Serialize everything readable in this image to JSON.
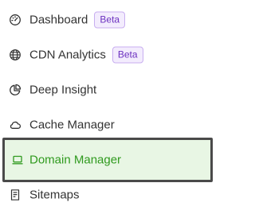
{
  "colors": {
    "text": "#333333",
    "active_text": "#2f9a1e",
    "active_bg": "#e8f6e4",
    "active_border": "#4a4a4a",
    "badge_text": "#6b2fbf",
    "badge_bg": "#f3ecfd",
    "badge_border": "#c8aef0"
  },
  "sidebar": {
    "items": [
      {
        "label": "Dashboard",
        "icon": "gauge-icon",
        "badge": "Beta"
      },
      {
        "label": "CDN Analytics",
        "icon": "globe-icon",
        "badge": "Beta"
      },
      {
        "label": "Deep Insight",
        "icon": "pie-chart-icon"
      },
      {
        "label": "Cache Manager",
        "icon": "cloud-icon"
      },
      {
        "label": "Domain Manager",
        "icon": "laptop-icon",
        "active": true
      },
      {
        "label": "Sitemaps",
        "icon": "document-list-icon"
      }
    ]
  }
}
